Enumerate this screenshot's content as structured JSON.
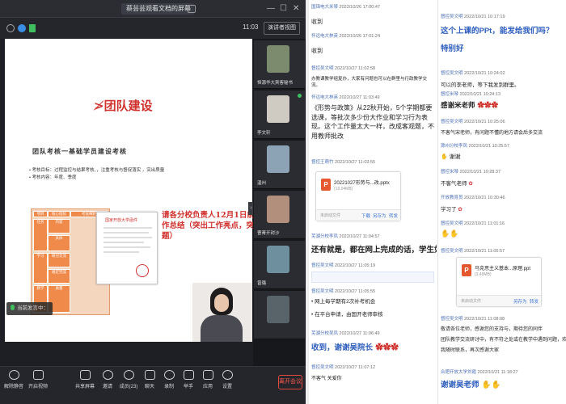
{
  "meeting": {
    "window_title": "蔡芸芸观看文档的屏幕",
    "timer": "11:03",
    "speaker_mode": "演讲者视图",
    "slide": {
      "title": "≯团队建设",
      "heading": "团队考核一基础学员建设考核",
      "bullets": [
        "• 考核目标：过程监控与结果考核、，注重考核与督促落实 ，突出质量",
        "• 考核内容：年度、季度"
      ],
      "panel_cells": [
        "项目",
        "核心指标",
        "考核细则",
        "任务",
        "内容",
        "具体",
        "学习",
        "研讨交流",
        "规定完成",
        "教学",
        "质量"
      ],
      "doc_title": "国家开放大学函件",
      "note": "请各分校负责人12月1日前交工作总结（突出工作亮点，突出问题）"
    },
    "speaking": "当前发言中：",
    "tiles": [
      {
        "name": "恒源华大宾客秘书",
        "color": "#7c8b6e"
      },
      {
        "name": "李文轩",
        "color": "#cfcac2"
      },
      {
        "name": "温州",
        "color": "#8ca3b5"
      },
      {
        "name": "曹菁开封沙",
        "color": "#b28e7c"
      },
      {
        "name": "曾璐",
        "color": "#6d8f9e"
      },
      {
        "name": "",
        "color": "#59646a"
      }
    ],
    "toolbar": [
      "解除静音",
      "开启视频",
      "共享屏幕",
      "邀请",
      "成员(23)",
      "聊天",
      "录制",
      "举手",
      "应用",
      "设置"
    ],
    "leave": "离开会议"
  },
  "chat_left": [
    {
      "sender": "国锦电大米琴",
      "time": "2022/10/26 17:00:47",
      "body": "收到"
    },
    {
      "sender": "怀远电大林英",
      "time": "2022/10/26 17:01:24",
      "body": "收到"
    },
    {
      "sender": "督控吴文明",
      "time": "2022/10/27 11:02:58",
      "body": "办教课教学组复办，大家有问题也可以在群里与行政教学交流。"
    },
    {
      "sender": "怀远电大林英",
      "time": "2022/10/27 11:03:49",
      "body": "《形势与政策》从22秋开始，5个学期都要选课，等批次多少份大作业和学习行为表现。这个工作量太大一样，改成客观题，不用教师批改"
    },
    {
      "sender": "督控王萌竹",
      "time": "2022/10/27 11:03:55",
      "body": ""
    },
    {
      "file_name": "20221027形势与...改.pptx",
      "file_size": "(19.04MB)",
      "status": "未启动文件",
      "actions": [
        "下载",
        "另存为",
        "转发"
      ]
    },
    {
      "sender": "芜湖分校李凤",
      "time": "2022/10/27 11:04:57",
      "body": "还有就是，都在网上完成的话，学生如"
    },
    {
      "sender": "督控吴文明",
      "time": "2022/10/27 11:05:19",
      "body": ""
    },
    {
      "sender": "督控吴文明",
      "time": "2022/10/27 11:05:55",
      "body": "• 网上每学期有2次补考机会"
    },
    {
      "sender": "",
      "time": "",
      "body": "• 在平台申请，由国开老师审核"
    },
    {
      "sender": "芜湖分校吴凤",
      "time": "2022/10/27 11:06:49",
      "body": "收到，谢谢吴院长"
    },
    {
      "sender": "督控吴文明",
      "time": "2022/10/27 11:07:12",
      "body": "不客气 关爱你"
    }
  ],
  "chat_right": [
    {
      "sender": "督控吴文明",
      "time": "2022/10/21 10:17:19",
      "body": "这个上课的PPt，能发给我们吗？"
    },
    {
      "sender": "",
      "time": "",
      "body": "特别好"
    },
    {
      "sender": "督控吴文明",
      "time": "2022/10/21 10:24:02",
      "body": "可以的李老师，等下我发到群里。"
    },
    {
      "sender": "督控米琴",
      "time": "2022/10/21 10:24:13",
      "body": "感谢米老师"
    },
    {
      "sender": "督控吴文明",
      "time": "2022/10/21 10:25:06",
      "body": "不客气宋老师，有问题不懂的地方请会后多交流"
    },
    {
      "sender": "滁州分校李凤",
      "time": "2022/10/21 10:25:57",
      "body": "谢谢"
    },
    {
      "sender": "督控米琴",
      "time": "2022/10/21 10:28:37",
      "body": "不客气老师"
    },
    {
      "sender": "开放教育员",
      "time": "2022/10/21 10:30:46",
      "body": "学习了"
    },
    {
      "sender": "督控吴文明",
      "time": "2022/10/21 11:01:16",
      "body": ""
    },
    {
      "sender": "督控吴文明",
      "time": "2022/10/21 11:05:57",
      "body": ""
    },
    {
      "file_name": "马克思主义基本...原理.ppt",
      "file_size": "(3.49MB)",
      "status": "未启动文件",
      "actions": [
        "另存为",
        "转发"
      ]
    },
    {
      "sender": "督控吴文明",
      "time": "2022/10/21 11:08:08",
      "body": "敬请各位老师，感谢您的支持与，期待您的同伴"
    },
    {
      "sender": "",
      "time": "",
      "body": "团队教学交流研讨中，有不符之处或在教学中遇到问题，欢迎"
    },
    {
      "sender": "",
      "time": "",
      "body": "我随时联系，再次感谢大家"
    },
    {
      "sender": "合肥开放大学刘霞",
      "time": "2022/10/21 11:18:27",
      "body": "谢谢吴老师"
    }
  ],
  "colors": {
    "accent_red": "#d0312d",
    "link_blue": "#3b73d8",
    "toolbar_bg": "#24262c"
  }
}
